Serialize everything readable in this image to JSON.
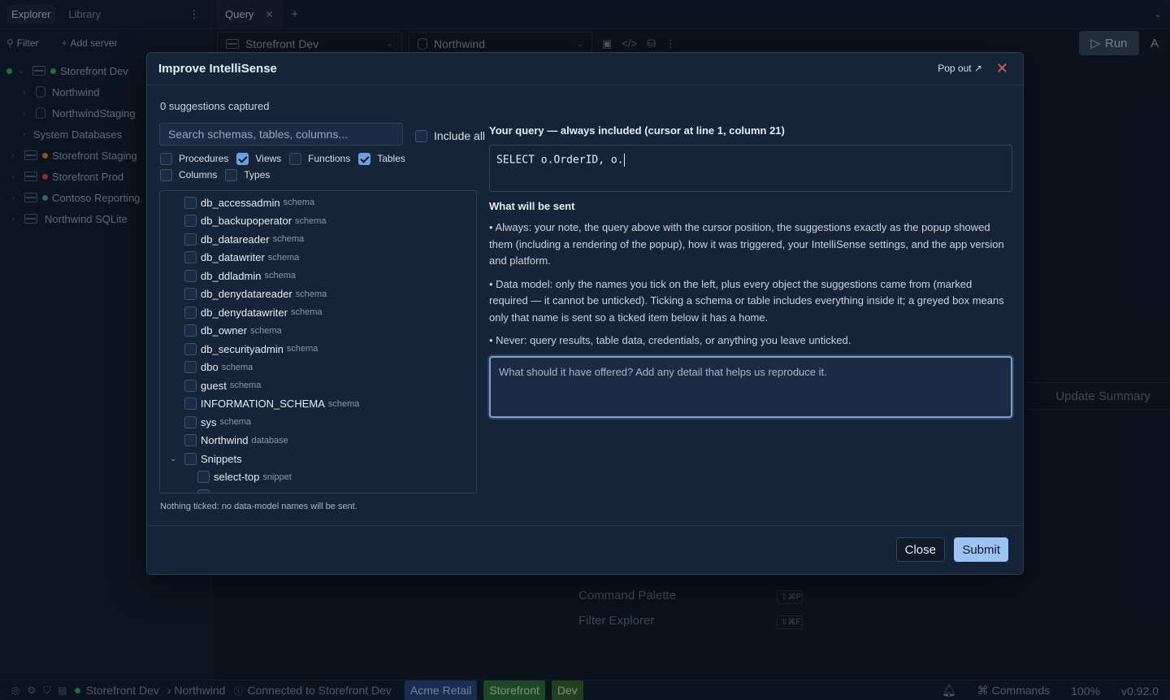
{
  "sidebar": {
    "tabs": [
      "Explorer",
      "Library"
    ],
    "tools": {
      "filter": "Filter",
      "add_server": "Add server"
    },
    "tree": [
      {
        "label": "Storefront Dev",
        "dot": "#2fbf5f",
        "kind": "server",
        "expanded": true
      },
      {
        "label": "Northwind",
        "kind": "db"
      },
      {
        "label": "NorthwindStaging",
        "kind": "db"
      },
      {
        "label": "System Databases",
        "kind": "folder"
      },
      {
        "label": "Storefront Staging",
        "dot": "#e08a3a",
        "kind": "server"
      },
      {
        "label": "Storefront Prod",
        "dot": "#e05050",
        "kind": "server"
      },
      {
        "label": "Contoso Reporting",
        "dot": "#4fb0c6",
        "kind": "server"
      },
      {
        "label": "Northwind SQLite",
        "kind": "server"
      }
    ]
  },
  "tabbar": {
    "tab": "Query"
  },
  "toolbar": {
    "server": "Storefront Dev",
    "database": "Northwind",
    "run": "Run",
    "extra": "A"
  },
  "behind": {
    "update_summary": "Update Summary",
    "hints": [
      {
        "label": "Command Palette",
        "kbd": "⇧⌘P"
      },
      {
        "label": "Filter Explorer",
        "kbd": "⇧⌘F"
      }
    ]
  },
  "status": {
    "connection": "Storefront Dev",
    "database": "› Northwind",
    "connected": "Connected to Storefront Dev",
    "badges": [
      {
        "label": "Acme Retail",
        "bg": "#274a82",
        "fg": "#cfe0ff"
      },
      {
        "label": "Storefront",
        "bg": "#2f7a3a",
        "fg": "#e2f5e4"
      },
      {
        "label": "Dev",
        "bg": "#3a6a2a",
        "fg": "#e6f2da"
      }
    ],
    "commands": "Commands",
    "zoom": "100%",
    "version": "v0.92.0"
  },
  "dialog": {
    "title": "Improve IntelliSense",
    "pop_out": "Pop out ↗",
    "captured": "0 suggestions captured",
    "search_placeholder": "Search schemas, tables, columns...",
    "include_all": "Include all",
    "filters": [
      {
        "label": "Procedures",
        "checked": false
      },
      {
        "label": "Views",
        "checked": true
      },
      {
        "label": "Functions",
        "checked": false
      },
      {
        "label": "Tables",
        "checked": true
      },
      {
        "label": "Columns",
        "checked": false
      },
      {
        "label": "Types",
        "checked": false
      }
    ],
    "items": [
      {
        "name": "db_accessadmin",
        "type": "schema"
      },
      {
        "name": "db_backupoperator",
        "type": "schema"
      },
      {
        "name": "db_datareader",
        "type": "schema"
      },
      {
        "name": "db_datawriter",
        "type": "schema"
      },
      {
        "name": "db_ddladmin",
        "type": "schema"
      },
      {
        "name": "db_denydatareader",
        "type": "schema"
      },
      {
        "name": "db_denydatawriter",
        "type": "schema"
      },
      {
        "name": "db_owner",
        "type": "schema"
      },
      {
        "name": "db_securityadmin",
        "type": "schema"
      },
      {
        "name": "dbo",
        "type": "schema"
      },
      {
        "name": "guest",
        "type": "schema"
      },
      {
        "name": "INFORMATION_SCHEMA",
        "type": "schema"
      },
      {
        "name": "sys",
        "type": "schema"
      },
      {
        "name": "Northwind",
        "type": "database"
      }
    ],
    "snippets_group": "Snippets",
    "snippet_items": [
      {
        "name": "select-top",
        "type": "snippet"
      },
      {
        "name": "",
        "type": ""
      }
    ],
    "nothing_ticked": "Nothing ticked: no data-model names will be sent.",
    "query_heading": "Your query — always included (cursor at line 1, column 21)",
    "query_text": "SELECT o.OrderID, o.",
    "sent_heading": "What will be sent",
    "bullets": [
      "• Always: your note, the query above with the cursor position, the suggestions exactly as the popup showed them (including a rendering of the popup), how it was triggered, your IntelliSense settings, and the app version and platform.",
      "• Data model: only the names you tick on the left, plus every object the suggestions came from (marked required — it cannot be unticked). Ticking a schema or table includes everything inside it; a greyed box means only that name is sent so a ticked item below it has a home.",
      "• Never: query results, table data, credentials, or anything you leave unticked."
    ],
    "note_placeholder": "What should it have offered? Add any detail that helps us reproduce it.",
    "close": "Close",
    "submit": "Submit"
  }
}
